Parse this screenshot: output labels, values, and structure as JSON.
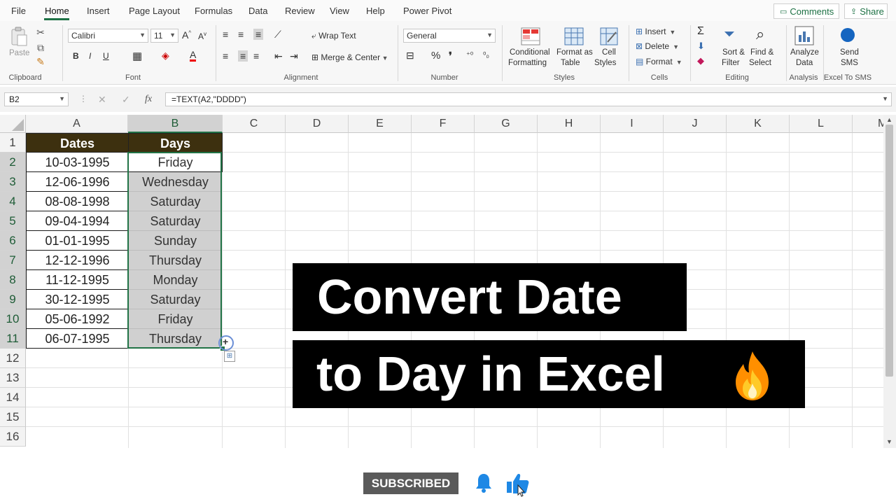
{
  "menu": {
    "tabs": [
      "File",
      "Home",
      "Insert",
      "Page Layout",
      "Formulas",
      "Data",
      "Review",
      "View",
      "Help",
      "Power Pivot"
    ],
    "comments": "Comments",
    "share": "Share"
  },
  "ribbon": {
    "clipboard": {
      "paste": "Paste",
      "label": "Clipboard"
    },
    "font": {
      "name": "Calibri",
      "size": "11",
      "label": "Font"
    },
    "alignment": {
      "wrap_text": "Wrap Text",
      "merge_center": "Merge & Center",
      "label": "Alignment"
    },
    "number": {
      "format": "General",
      "label": "Number"
    },
    "styles": {
      "conditional_1": "Conditional",
      "conditional_2": "Formatting",
      "format_as_1": "Format as",
      "format_as_2": "Table",
      "cell_styles_1": "Cell",
      "cell_styles_2": "Styles",
      "label": "Styles"
    },
    "cells": {
      "insert": "Insert",
      "delete": "Delete",
      "format": "Format",
      "label": "Cells"
    },
    "editing": {
      "sort_1": "Sort &",
      "sort_2": "Filter",
      "find_1": "Find &",
      "find_2": "Select",
      "label": "Editing"
    },
    "analysis": {
      "analyze_1": "Analyze",
      "analyze_2": "Data",
      "label": "Analysis"
    },
    "sms": {
      "send_1": "Send",
      "send_2": "SMS",
      "label": "Excel To SMS"
    }
  },
  "formula_bar": {
    "name_box": "B2",
    "formula": "=TEXT(A2,\"DDDD\")"
  },
  "grid": {
    "columns": [
      "A",
      "B",
      "C",
      "D",
      "E",
      "F",
      "G",
      "H",
      "I",
      "J",
      "K",
      "L",
      "M"
    ],
    "rows": [
      "1",
      "2",
      "3",
      "4",
      "5",
      "6",
      "7",
      "8",
      "9",
      "10",
      "11",
      "12",
      "13",
      "14",
      "15",
      "16"
    ],
    "headers": {
      "dates": "Dates",
      "days": "Days"
    },
    "data": [
      {
        "date": "10-03-1995",
        "day": "Friday"
      },
      {
        "date": "12-06-1996",
        "day": "Wednesday"
      },
      {
        "date": "08-08-1998",
        "day": "Saturday"
      },
      {
        "date": "09-04-1994",
        "day": "Saturday"
      },
      {
        "date": "01-01-1995",
        "day": "Sunday"
      },
      {
        "date": "12-12-1996",
        "day": "Thursday"
      },
      {
        "date": "11-12-1995",
        "day": "Monday"
      },
      {
        "date": "30-12-1995",
        "day": "Saturday"
      },
      {
        "date": "05-06-1992",
        "day": "Friday"
      },
      {
        "date": "06-07-1995",
        "day": "Thursday"
      }
    ]
  },
  "overlay": {
    "title_line1": "Convert Date",
    "title_line2": "to Day in Excel",
    "subscribed": "SUBSCRIBED"
  },
  "colors": {
    "accent": "#217346",
    "header_fill": "#3d300f",
    "banner": "#000000",
    "fire": "#ff9800",
    "bell": "#1e88e5"
  }
}
